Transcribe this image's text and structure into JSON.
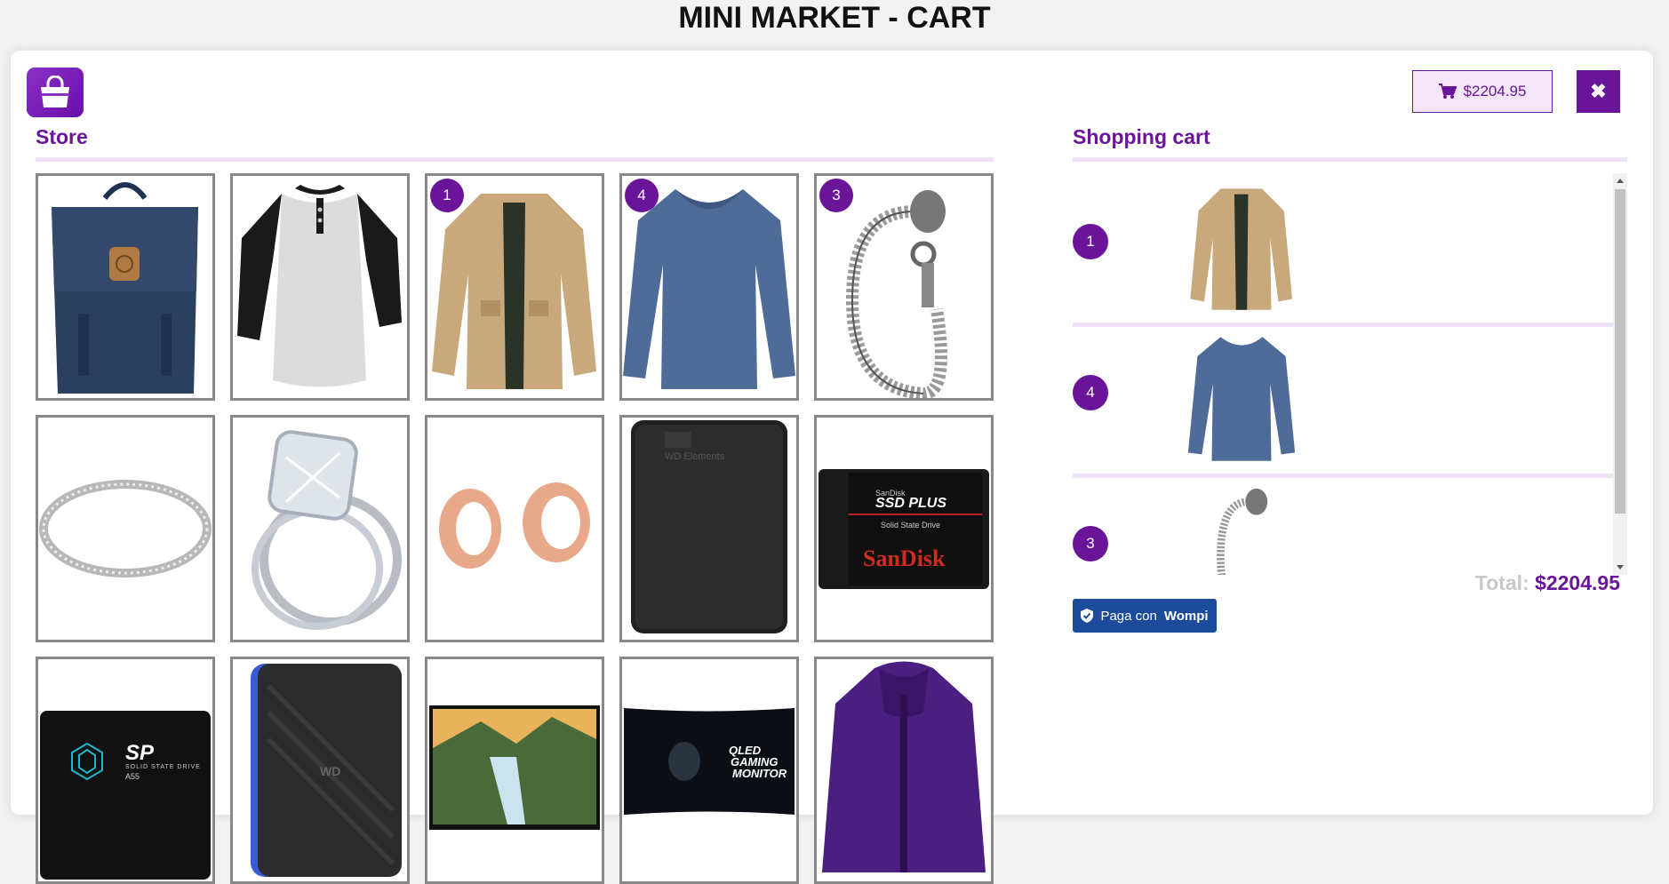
{
  "page": {
    "title": "MINI MARKET - CART"
  },
  "header": {
    "logo_icon": "shopping-bag-icon",
    "cart_total_label": "$2204.95",
    "cart_icon": "cart-icon",
    "close_icon": "close-icon"
  },
  "store": {
    "title": "Store",
    "products": [
      {
        "name": "backpack",
        "badge": ""
      },
      {
        "name": "raglan-tshirt",
        "badge": ""
      },
      {
        "name": "khaki-jacket",
        "badge": "1"
      },
      {
        "name": "blue-long-sleeve",
        "badge": "4"
      },
      {
        "name": "dragon-bracelet",
        "badge": "3"
      },
      {
        "name": "silver-ring",
        "badge": ""
      },
      {
        "name": "diamond-ring-set",
        "badge": ""
      },
      {
        "name": "rose-gold-plugs",
        "badge": ""
      },
      {
        "name": "wd-elements-drive",
        "badge": ""
      },
      {
        "name": "sandisk-ssd-plus",
        "badge": ""
      },
      {
        "name": "sp-ssd",
        "badge": ""
      },
      {
        "name": "wd-gaming-drive",
        "badge": ""
      },
      {
        "name": "landscape-monitor",
        "badge": ""
      },
      {
        "name": "qled-gaming-monitor",
        "badge": ""
      },
      {
        "name": "purple-jacket",
        "badge": ""
      }
    ],
    "text": {
      "wd_label": "WD Elements",
      "sandisk_top": "SanDisk",
      "sandisk_model": "SSD PLUS",
      "sandisk_sub": "Solid State Drive",
      "sandisk_brand": "SanDisk",
      "sp_logo": "SP",
      "sp_sub": "SOLID STATE DRIVE",
      "sp_model": "A55",
      "wd_logo": "WD",
      "qled_line1": "QLED",
      "qled_line2": "GAMING",
      "qled_line3": "MONITOR"
    }
  },
  "cart": {
    "title": "Shopping cart",
    "items": [
      {
        "qty": "1",
        "product": "khaki-jacket"
      },
      {
        "qty": "4",
        "product": "blue-long-sleeve"
      },
      {
        "qty": "3",
        "product": "dragon-bracelet"
      }
    ],
    "total_label": "Total:",
    "total_value": "$2204.95",
    "pay_prefix": "Paga con",
    "pay_brand": "Wompi"
  },
  "colors": {
    "accent": "#6a1599",
    "pay": "#1d4b9b"
  }
}
